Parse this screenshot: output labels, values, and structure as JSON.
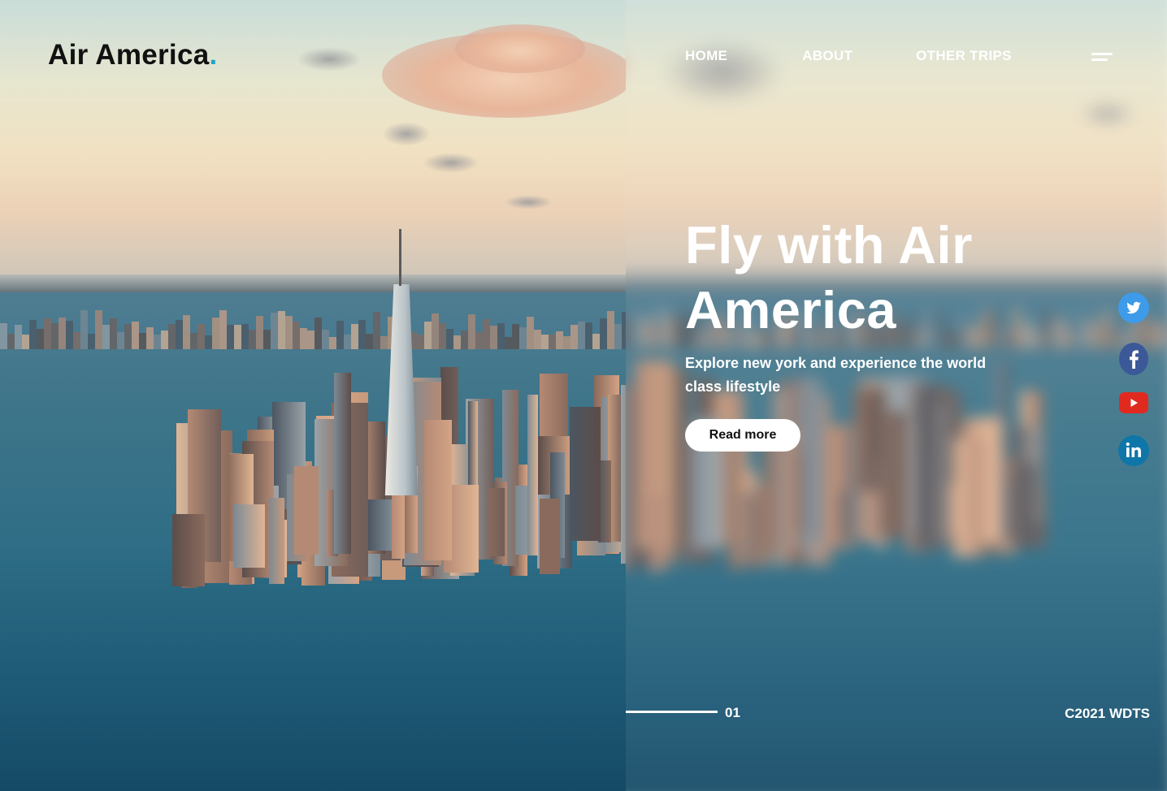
{
  "brand": {
    "name": "Air America",
    "dot": ".",
    "dot_color": "#1fa6c7"
  },
  "nav": {
    "items": [
      {
        "label": "HOME"
      },
      {
        "label": "ABOUT"
      },
      {
        "label": "OTHER TRIPS"
      }
    ],
    "menu_icon": "hamburger-menu-icon"
  },
  "hero": {
    "title": "Fly with Air America",
    "subtitle": "Explore new york and experience the world class lifestyle",
    "cta_label": "Read more"
  },
  "social": [
    {
      "icon": "twitter-icon",
      "color": "#3d9be9"
    },
    {
      "icon": "facebook-icon",
      "color": "#3b5998"
    },
    {
      "icon": "youtube-icon",
      "color": "#e02a20"
    },
    {
      "icon": "linkedin-icon",
      "color": "#0e76a8"
    }
  ],
  "footer": {
    "slide_number": "01",
    "copyright": "C2021 WDTS"
  },
  "background": {
    "image": "aerial-new-york-skyline",
    "right_half_blurred": true
  }
}
